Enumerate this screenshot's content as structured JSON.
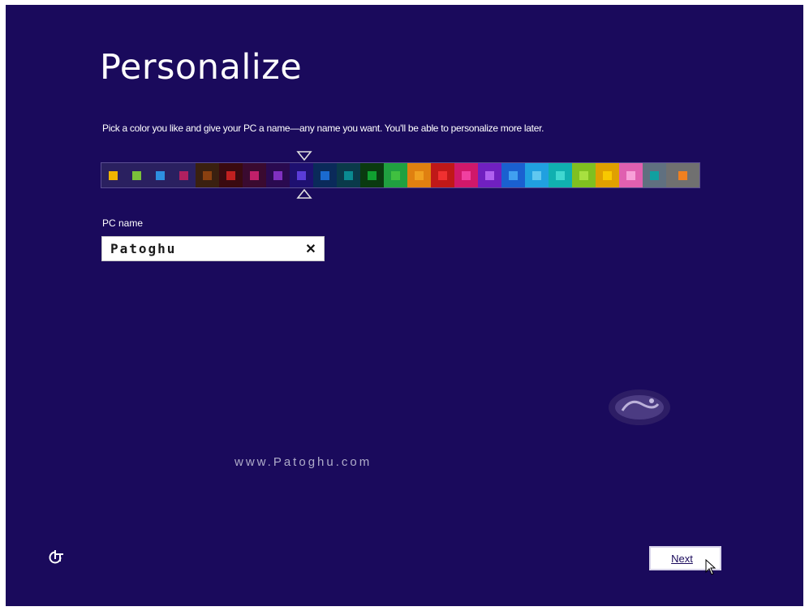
{
  "page": {
    "title": "Personalize",
    "subtitle": "Pick a color you like and give your PC a name—any name you want. You'll be able to personalize more later.",
    "background_color": "#1a0a5c"
  },
  "color_picker": {
    "selected_index": 8,
    "swatches": [
      {
        "bg": "#2a2060",
        "fg": "#f0b400"
      },
      {
        "bg": "#2a2060",
        "fg": "#7ac13a"
      },
      {
        "bg": "#2a2060",
        "fg": "#2d8fe0"
      },
      {
        "bg": "#2a2060",
        "fg": "#b02060"
      },
      {
        "bg": "#3a2010",
        "fg": "#8a4010"
      },
      {
        "bg": "#3a0a10",
        "fg": "#c02020"
      },
      {
        "bg": "#3a0a30",
        "fg": "#c0206a"
      },
      {
        "bg": "#2a0a50",
        "fg": "#8030c0"
      },
      {
        "bg": "#1e1070",
        "fg": "#5a3cd8"
      },
      {
        "bg": "#0a2a5a",
        "fg": "#1a6ad0"
      },
      {
        "bg": "#0a3a4a",
        "fg": "#0a8a90"
      },
      {
        "bg": "#0a3a10",
        "fg": "#10a030"
      },
      {
        "bg": "#20a040",
        "fg": "#40c040"
      },
      {
        "bg": "#e08010",
        "fg": "#f0a020"
      },
      {
        "bg": "#c01818",
        "fg": "#f03030"
      },
      {
        "bg": "#d0186a",
        "fg": "#f040a0"
      },
      {
        "bg": "#7020c0",
        "fg": "#b060f0"
      },
      {
        "bg": "#1a60d0",
        "fg": "#40a0f0"
      },
      {
        "bg": "#20a0e0",
        "fg": "#60c8f0"
      },
      {
        "bg": "#10b0b0",
        "fg": "#40d8d0"
      },
      {
        "bg": "#80c020",
        "fg": "#a8e040"
      },
      {
        "bg": "#e0a000",
        "fg": "#f8c800"
      },
      {
        "bg": "#e060b0",
        "fg": "#f8a0d8"
      },
      {
        "bg": "#607080",
        "fg": "#10a0a0"
      },
      {
        "bg": "#707070",
        "fg": "#f08020"
      }
    ]
  },
  "pc_name": {
    "label": "PC name",
    "value": "Patoghu",
    "clear_glyph": "✕"
  },
  "watermark": {
    "url": "www.Patoghu.com"
  },
  "footer": {
    "next_label": "Next",
    "ease_of_access_icon": "ease-of-access-icon"
  }
}
